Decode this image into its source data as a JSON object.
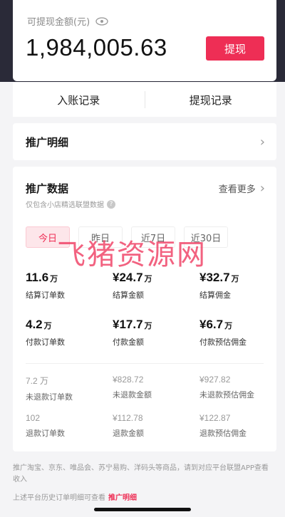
{
  "balance": {
    "label": "可提现金额(元)",
    "value": "1,984,005.63",
    "withdraw_label": "提现"
  },
  "records": {
    "income_label": "入账记录",
    "withdraw_label": "提现记录"
  },
  "promo_detail": {
    "title": "推广明细"
  },
  "promo_data": {
    "title": "推广数据",
    "see_more": "查看更多",
    "subtitle": "仅包含小店精选联盟数据",
    "date_tabs": [
      "今日",
      "昨日",
      "近7日",
      "近30日"
    ],
    "metrics_row1": [
      {
        "value": "11.6",
        "unit": "万",
        "label": "结算订单数"
      },
      {
        "value": "¥24.7",
        "unit": "万",
        "label": "结算金额"
      },
      {
        "value": "¥32.7",
        "unit": "万",
        "label": "结算佣金"
      }
    ],
    "metrics_row2": [
      {
        "value": "4.2",
        "unit": "万",
        "label": "付款订单数"
      },
      {
        "value": "¥17.7",
        "unit": "万",
        "label": "付款金额"
      },
      {
        "value": "¥6.7",
        "unit": "万",
        "label": "付款预估佣金"
      }
    ],
    "metrics_row3": [
      {
        "value": "7.2 万",
        "label": "未退款订单数"
      },
      {
        "value": "¥828.72",
        "label": "未退款金额"
      },
      {
        "value": "¥927.82",
        "label": "未退款预估佣金"
      }
    ],
    "metrics_row4": [
      {
        "value": "102",
        "label": "退款订单数"
      },
      {
        "value": "¥112.78",
        "label": "退款金额"
      },
      {
        "value": "¥122.87",
        "label": "退款预估佣金"
      }
    ]
  },
  "footer": {
    "note": "推广淘宝、京东、唯品会、苏宁易购、洋码头等商品，请到对应平台联盟APP查看收入",
    "history_text": "上述平台历史订单明细可查看",
    "history_link": "推广明细"
  },
  "watermark": "飞猪资源网",
  "colors": {
    "accent": "#ee2e55",
    "header_bg": "#2a2a38",
    "page_bg": "#f4f4f6"
  }
}
